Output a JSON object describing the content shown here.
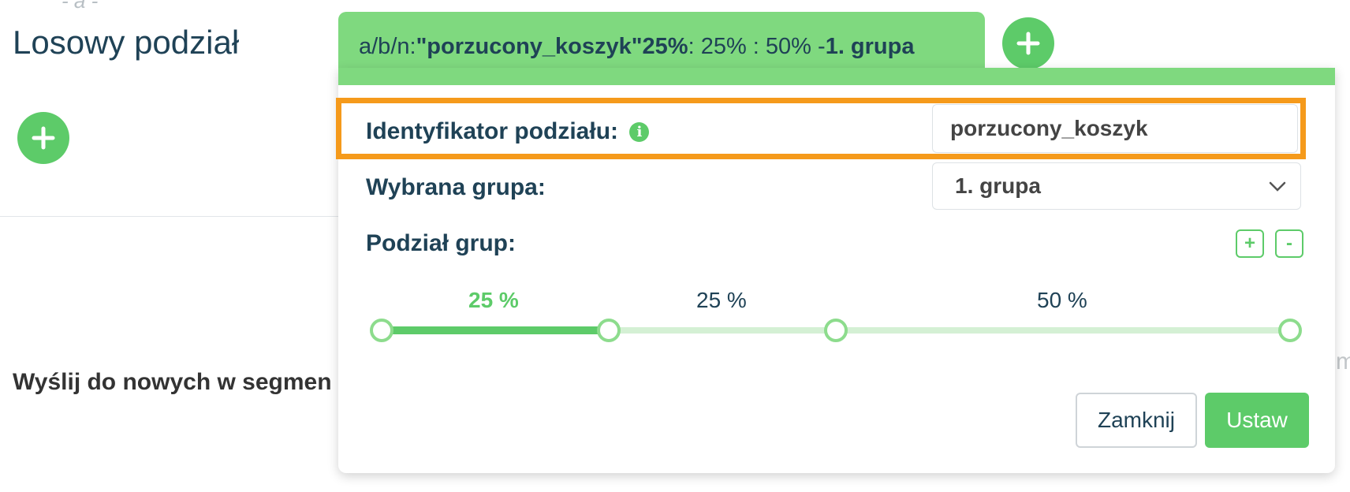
{
  "background": {
    "hint": "- a -",
    "title": "Losowy podział",
    "send_label": "Wyślij do nowych w segmen",
    "edge_text": "m"
  },
  "tab": {
    "prefix": "a/b/n: ",
    "id_quoted": "\"porzucony_koszyk\"",
    "active_pct": " 25%",
    "rest": " : 25% : 50% - ",
    "group": "1. grupa"
  },
  "form": {
    "id_label": "Identyfikator podziału:",
    "id_value": "porzucony_koszyk",
    "group_label": "Wybrana grupa:",
    "group_value": "1. grupa",
    "split_label": "Podział grup:",
    "add_symbol": "+",
    "remove_symbol": "-"
  },
  "split": {
    "percentages": [
      "25 %",
      "25 %",
      "50 %"
    ],
    "values": [
      25,
      25,
      50
    ],
    "active_index": 0
  },
  "buttons": {
    "close": "Zamknij",
    "set": "Ustaw"
  },
  "colors": {
    "accent": "#5dcb69",
    "tab": "#7fd97f",
    "highlight": "#f59a1b",
    "text": "#1f4256"
  },
  "icons": [
    "plus-icon",
    "info-icon",
    "chevron-down-icon"
  ]
}
